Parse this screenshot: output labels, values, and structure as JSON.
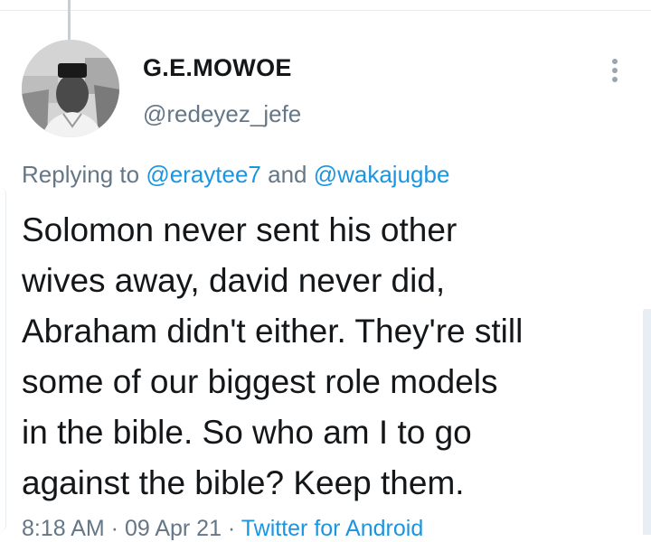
{
  "user": {
    "display_name": "G.E.MOWOE",
    "handle": "@redeyez_jefe",
    "avatar_icon": "profile-photo"
  },
  "more_icon": "more-vertical-icon",
  "reply": {
    "prefix": "Replying to ",
    "mention1": "@eraytee7",
    "conjunction": " and ",
    "mention2": "@wakajugbe"
  },
  "tweet": {
    "lines": [
      "Solomon never sent his other",
      "wives away, david never did,",
      "Abraham didn't either. They're still",
      "some of our biggest role models",
      "in the bible. So who am I to go",
      "against the bible? Keep them."
    ]
  },
  "meta": {
    "time": "8:18 AM",
    "separator": " · ",
    "date": "09 Apr 21",
    "source": "Twitter for Android"
  },
  "colors": {
    "link": "#1b95e0",
    "secondary": "#657786",
    "text": "#14171a"
  }
}
